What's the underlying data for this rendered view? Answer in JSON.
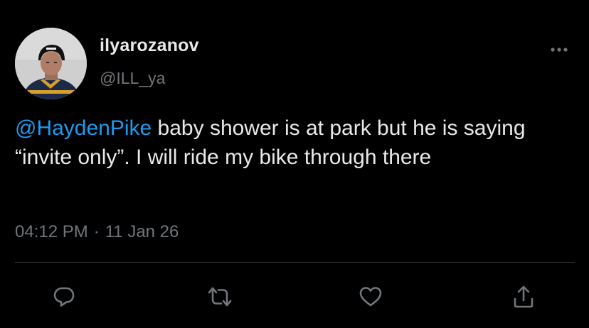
{
  "tweet": {
    "display_name": "ilyarozanov",
    "handle": "@ILL_ya",
    "mention": "@HaydenPike",
    "text_rest": " baby shower is at park but he is saying “invite only”. I will ride my bike through there",
    "time": "04:12 PM",
    "separator": "·",
    "date": "11 Jan 26"
  },
  "icons": {
    "more": "more-horizontal-icon",
    "reply": "reply-icon",
    "retweet": "retweet-icon",
    "like": "heart-icon",
    "share": "share-icon"
  },
  "colors": {
    "background": "#000000",
    "text": "#e7e9ea",
    "secondary": "#71767b",
    "link": "#1d9bf0",
    "divider": "#2f3336"
  }
}
